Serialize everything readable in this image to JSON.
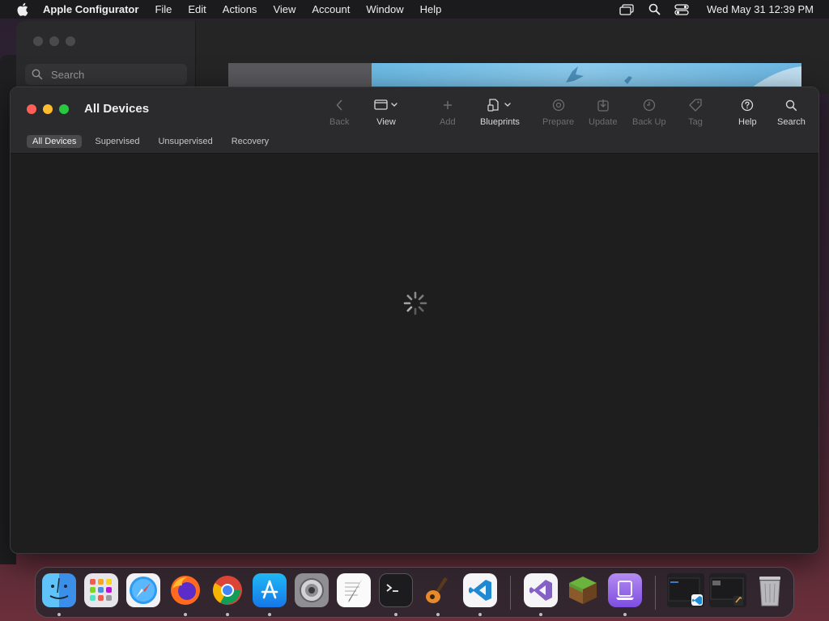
{
  "menubar": {
    "apple_icon": "apple-logo-icon",
    "app_name": "Apple Configurator",
    "items": [
      "File",
      "Edit",
      "Actions",
      "View",
      "Account",
      "Window",
      "Help"
    ],
    "status_icons": [
      "screen-mirroring-icon",
      "spotlight-search-icon",
      "control-center-icon"
    ],
    "clock": "Wed May 31  12:39 PM"
  },
  "background_window": {
    "search_placeholder": "Search"
  },
  "window": {
    "title": "All Devices",
    "toolbar": {
      "back": "Back",
      "view": "View",
      "add": "Add",
      "blueprints": "Blueprints",
      "prepare": "Prepare",
      "update": "Update",
      "backup": "Back Up",
      "tag": "Tag",
      "help": "Help",
      "search": "Search"
    },
    "scopes": [
      "All Devices",
      "Supervised",
      "Unsupervised",
      "Recovery"
    ],
    "active_scope": "All Devices",
    "loading": true
  },
  "dock": {
    "apps": [
      "finder-icon",
      "launchpad-icon",
      "safari-icon",
      "firefox-icon",
      "chrome-icon",
      "app-store-icon",
      "system-settings-icon",
      "textedit-icon",
      "terminal-icon",
      "garageband-icon",
      "vscode-icon",
      "visual-studio-icon",
      "minecraft-icon",
      "apple-configurator-icon",
      "vscode-window-thumbnail-icon",
      "terminal-window-thumbnail-icon",
      "trash-icon"
    ]
  },
  "colors": {
    "close": "#fe5f57",
    "minimize": "#febc2e",
    "maximize": "#28c840",
    "window_bg": "#1e1e1f",
    "titlebar_bg": "#2b2b2d"
  }
}
